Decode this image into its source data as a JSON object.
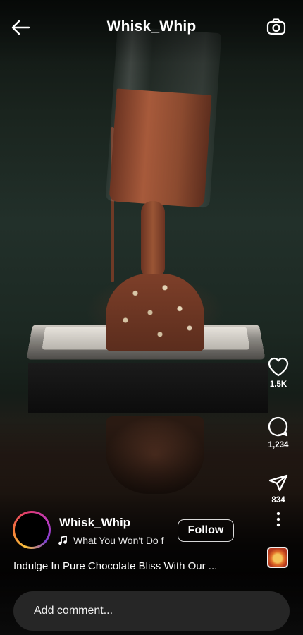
{
  "header": {
    "title": "Whisk_Whip",
    "back_icon": "arrow-left-icon",
    "camera_icon": "camera-icon"
  },
  "actions": {
    "likes": "1.5K",
    "comments": "1,234",
    "shares": "834"
  },
  "post": {
    "username": "Whisk_Whip",
    "audio_title": "What You Won't Do f",
    "follow_label": "Follow",
    "caption": "Indulge In Pure Chocolate Bliss With Our ..."
  },
  "comment": {
    "placeholder": "Add comment..."
  },
  "colors": {
    "background": "#000000",
    "comment_bar": "#262626",
    "text": "#ffffff"
  }
}
